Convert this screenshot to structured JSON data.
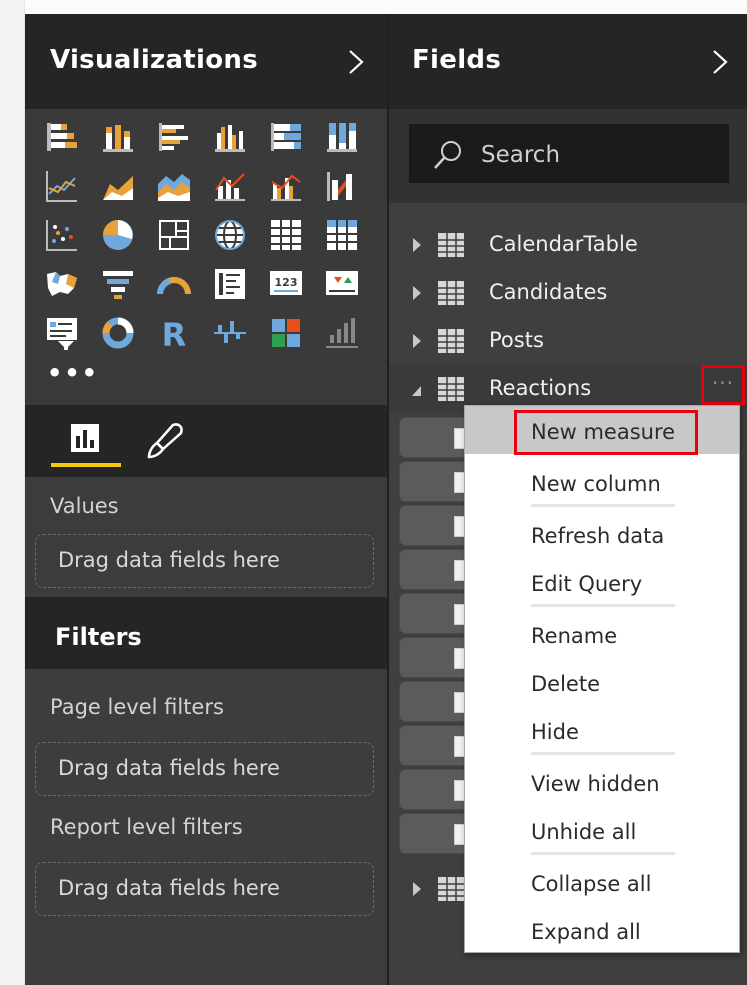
{
  "visualizations": {
    "title": "Visualizations",
    "more_label": "•••",
    "icons": [
      "stacked-bar-chart-icon",
      "stacked-column-chart-icon",
      "clustered-bar-chart-icon",
      "clustered-column-chart-icon",
      "100-stacked-bar-chart-icon",
      "100-stacked-column-chart-icon",
      "line-chart-icon",
      "area-chart-icon",
      "stacked-area-chart-icon",
      "line-and-stacked-column-chart-icon",
      "line-and-clustered-column-chart-icon",
      "ribbon-chart-icon",
      "scatter-chart-icon",
      "pie-chart-icon",
      "treemap-icon",
      "map-icon",
      "table-icon",
      "matrix-icon",
      "filled-map-icon",
      "funnel-icon",
      "gauge-icon",
      "multi-row-card-icon",
      "card-icon",
      "kpi-icon",
      "slicer-icon",
      "donut-chart-icon",
      "r-script-visual-icon",
      "waterfall-chart-icon",
      "shape-map-icon",
      "import-custom-visual-icon"
    ],
    "accent": "#f2c811"
  },
  "values_section": {
    "label": "Values",
    "drop_placeholder": "Drag data fields here"
  },
  "filters": {
    "title": "Filters",
    "page_level_label": "Page level filters",
    "page_drop_placeholder": "Drag data fields here",
    "report_level_label": "Report level filters",
    "report_drop_placeholder": "Drag data fields here"
  },
  "fields": {
    "title": "Fields",
    "search_placeholder": "Search",
    "tables": [
      {
        "label": "CalendarTable",
        "expanded": false
      },
      {
        "label": "Candidates",
        "expanded": false
      },
      {
        "label": "Posts",
        "expanded": false
      },
      {
        "label": "Reactions",
        "expanded": true
      }
    ],
    "more_label": "···",
    "highlight_color": "#e8000d"
  },
  "context_menu": {
    "items": [
      {
        "label": "New measure",
        "highlighted": true
      },
      {
        "label": "New column"
      },
      {
        "label": "Refresh data"
      },
      {
        "label": "Edit Query"
      },
      {
        "label": "Rename"
      },
      {
        "label": "Delete"
      },
      {
        "label": "Hide"
      },
      {
        "label": "View hidden"
      },
      {
        "label": "Unhide all"
      },
      {
        "label": "Collapse all"
      },
      {
        "label": "Expand all"
      }
    ]
  }
}
